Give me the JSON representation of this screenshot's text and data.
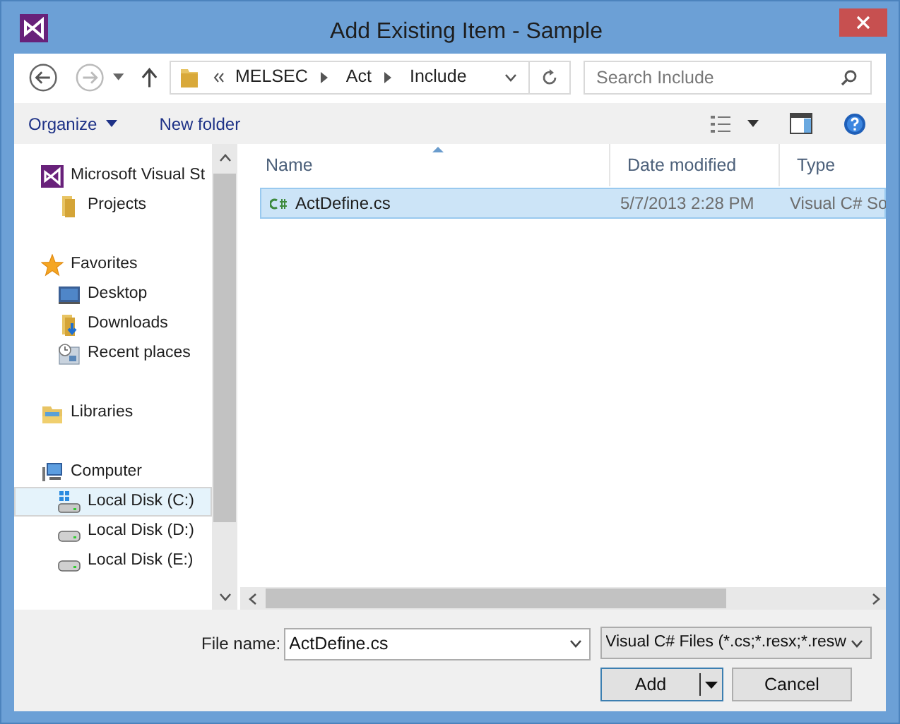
{
  "window": {
    "title": "Add Existing Item - Sample"
  },
  "address": {
    "segments": [
      "MELSEC",
      "Act",
      "Include"
    ],
    "search_placeholder": "Search Include"
  },
  "toolbar": [
    {
      "label": "Organize",
      "kind": "menu"
    },
    {
      "label": "New folder",
      "kind": "plain"
    }
  ],
  "navigation": [
    {
      "label": "Microsoft Visual St",
      "kind": "vs",
      "selected": false,
      "children": [
        {
          "label": "Projects",
          "kind": "folder",
          "selected": false
        }
      ]
    },
    {
      "label": "Favorites",
      "kind": "star",
      "selected": false,
      "children": [
        {
          "label": "Desktop",
          "kind": "desktop",
          "selected": false
        },
        {
          "label": "Downloads",
          "kind": "downloads",
          "selected": false
        },
        {
          "label": "Recent places",
          "kind": "recent",
          "selected": false
        }
      ]
    },
    {
      "label": "Libraries",
      "kind": "libraries",
      "selected": false
    },
    {
      "label": "Computer",
      "kind": "computer",
      "selected": false,
      "children": [
        {
          "label": "Local Disk (C:)",
          "kind": "disk-os",
          "selected": true
        },
        {
          "label": "Local Disk (D:)",
          "kind": "disk",
          "selected": false
        },
        {
          "label": "Local Disk (E:)",
          "kind": "disk",
          "selected": false
        }
      ]
    }
  ],
  "table": {
    "columns": [
      "Name",
      "Date modified",
      "Type"
    ],
    "rows": [
      {
        "name": "ActDefine.cs",
        "date": "5/7/2013 2:28 PM",
        "type": "Visual C# So",
        "selected": true
      }
    ]
  },
  "file_name": {
    "label": "File name:",
    "value": "ActDefine.cs"
  },
  "file_type": {
    "value": "Visual C# Files (*.cs;*.resx;*.resw"
  },
  "buttons": [
    {
      "label": "Add",
      "kind": "split"
    },
    {
      "label": "Cancel",
      "kind": "plain"
    }
  ]
}
